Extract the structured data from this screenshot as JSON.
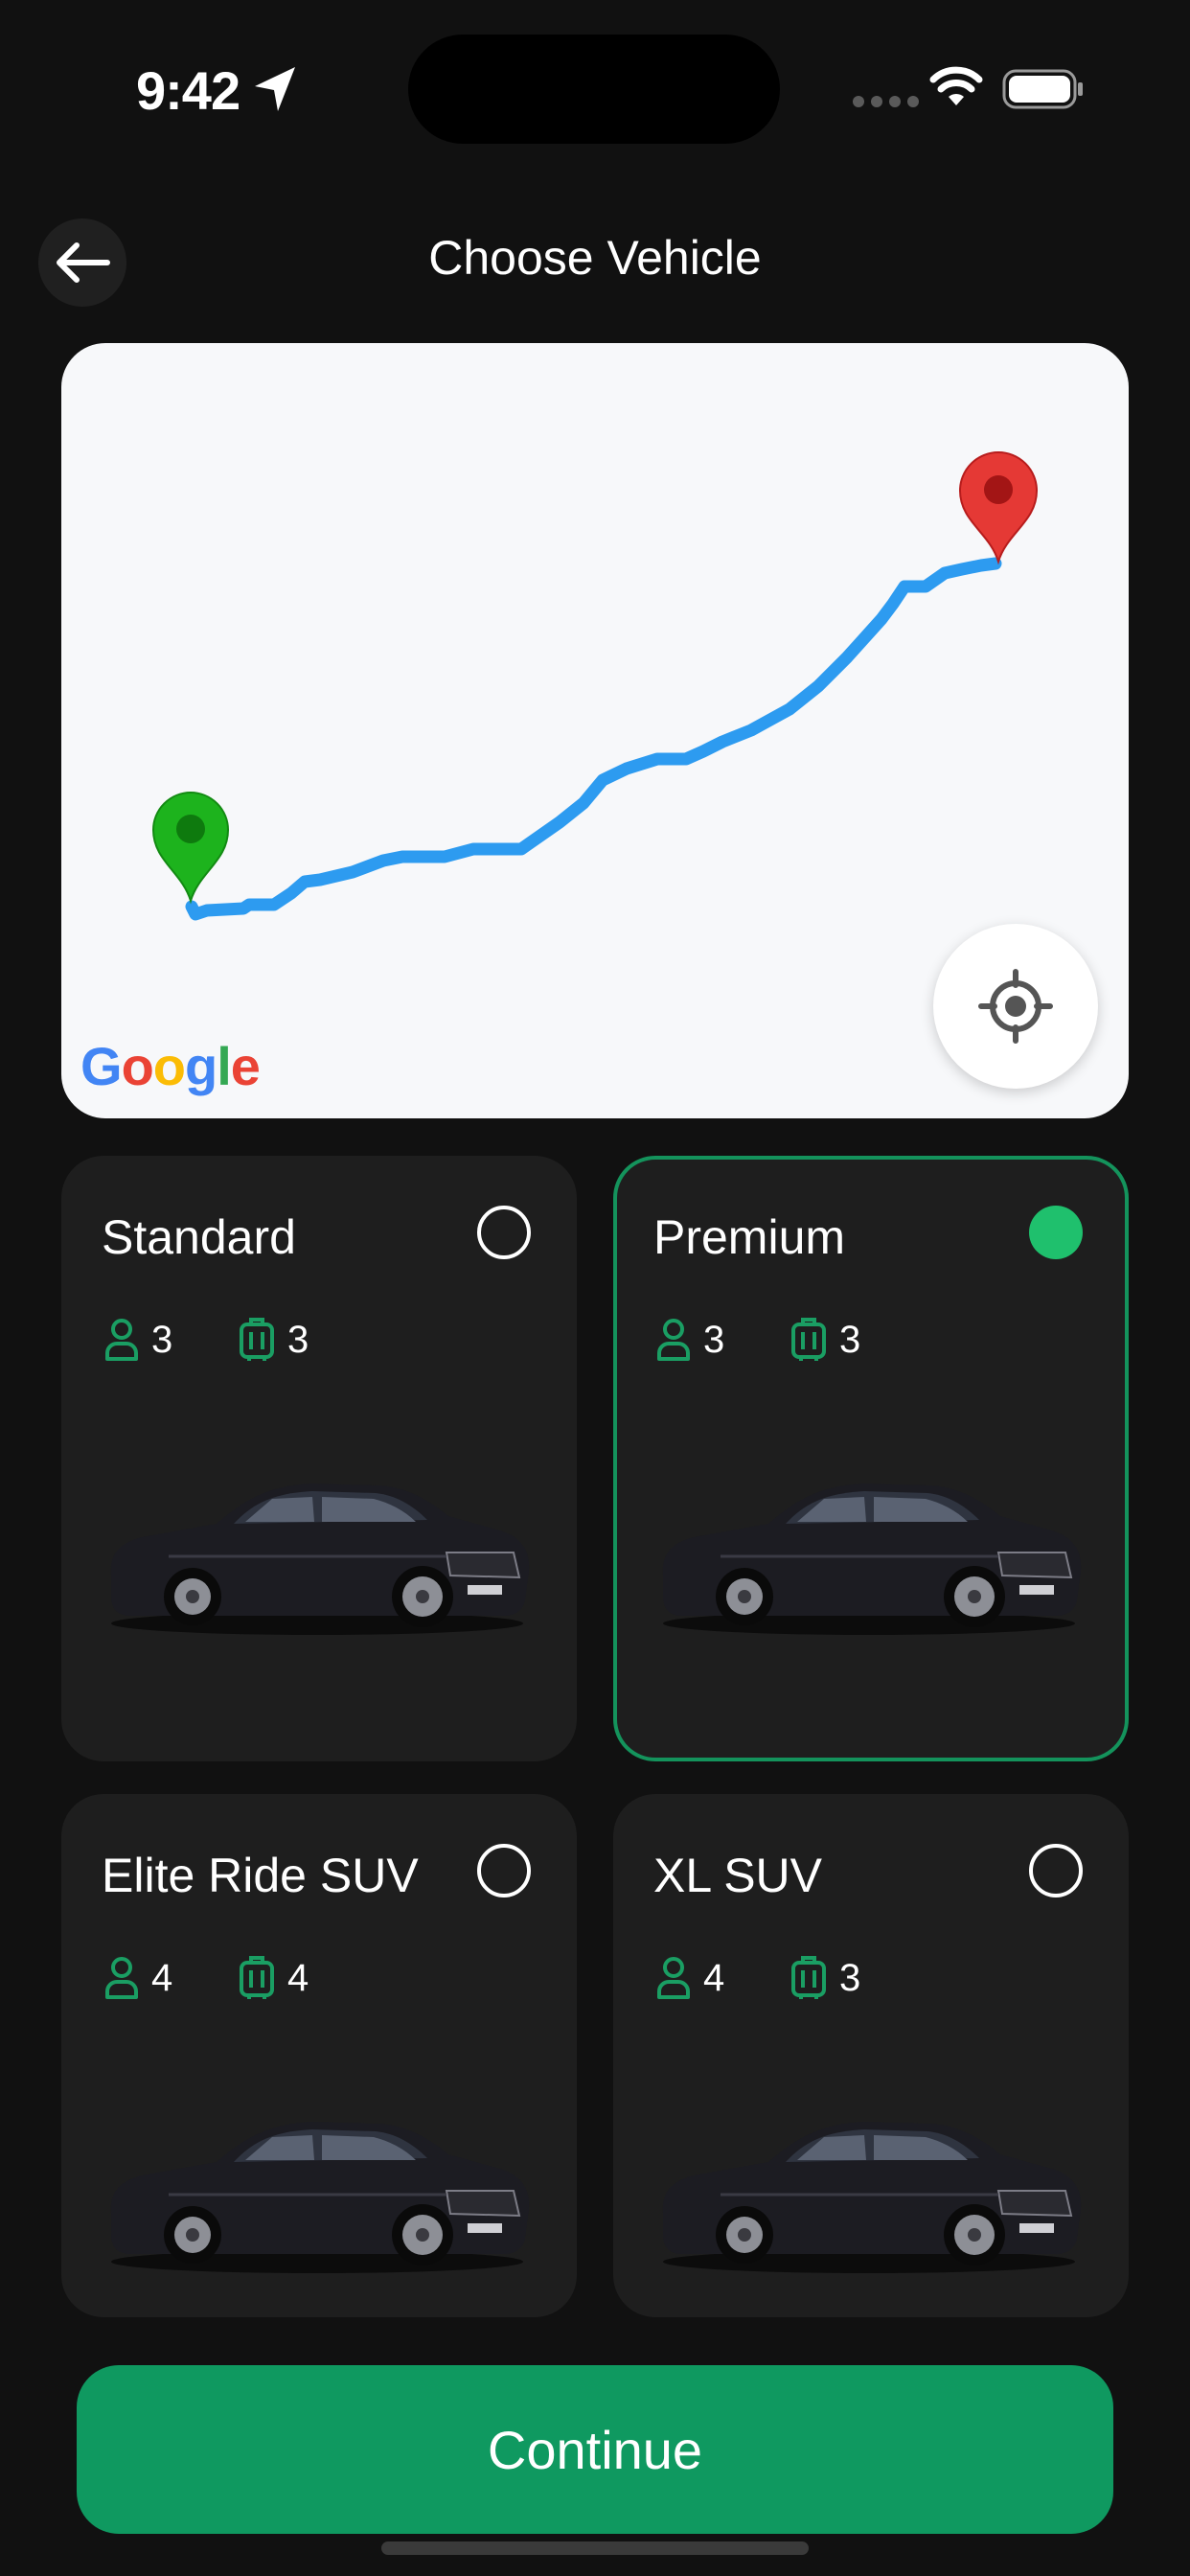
{
  "status_bar": {
    "time": "9:42"
  },
  "header": {
    "title": "Choose Vehicle",
    "back_icon": "arrow-left-icon"
  },
  "map": {
    "logo_text": [
      "G",
      "o",
      "o",
      "g",
      "l",
      "e"
    ],
    "logo_colors": [
      "#4285F4",
      "#EA4335",
      "#FBBC05",
      "#4285F4",
      "#34A853",
      "#EA4335"
    ],
    "route_color": "#2D9BF0",
    "origin_pin_color": "#1DB31D",
    "destination_pin_color": "#E53935",
    "locate_icon": "crosshair-icon"
  },
  "vehicles": [
    {
      "name": "Standard",
      "seats": "3",
      "bags": "3",
      "selected": false
    },
    {
      "name": "Premium",
      "seats": "3",
      "bags": "3",
      "selected": true
    },
    {
      "name": "Elite Ride SUV",
      "seats": "4",
      "bags": "4",
      "selected": false
    },
    {
      "name": "XL SUV",
      "seats": "4",
      "bags": "3",
      "selected": false
    }
  ],
  "colors": {
    "accent": "#0F9960",
    "selected_radio": "#1FC06D",
    "icon_green": "#1A9E63"
  },
  "footer": {
    "continue_label": "Continue"
  }
}
